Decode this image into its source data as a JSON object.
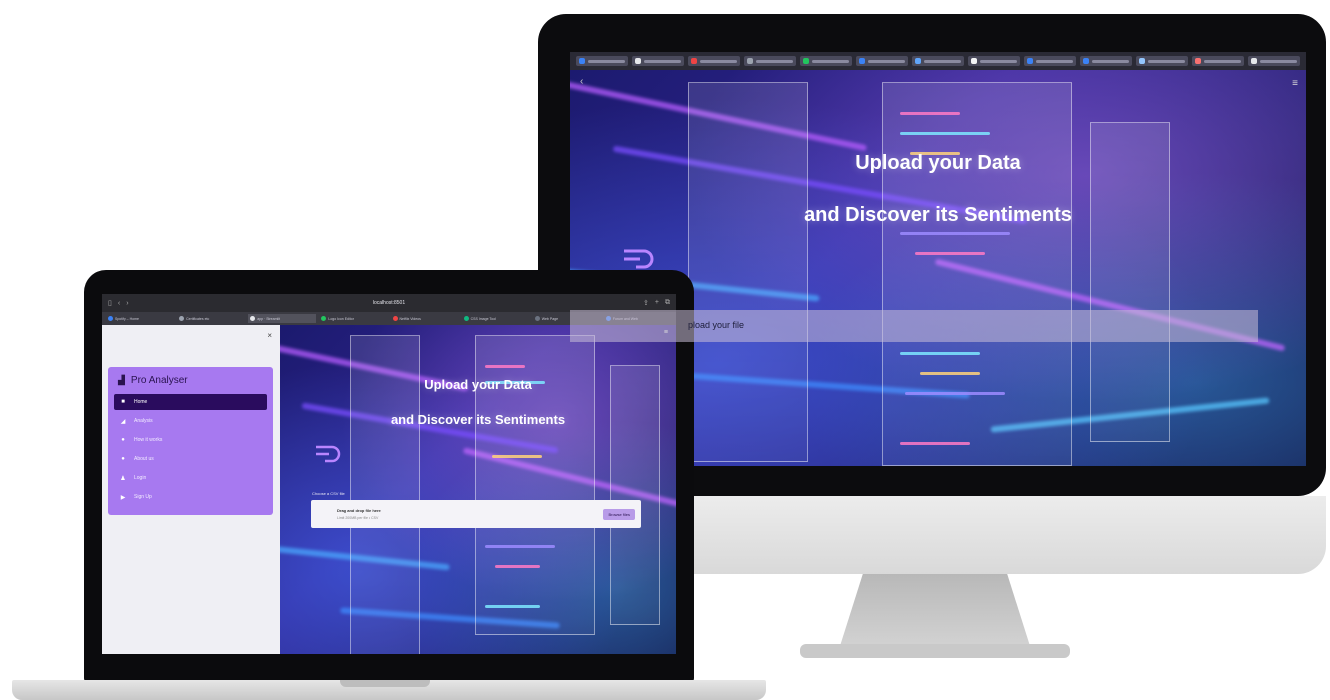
{
  "desktop": {
    "hero_line1": "Upload your Data",
    "hero_line2": "and Discover its Sentiments",
    "upload_label": "pload your file"
  },
  "laptop": {
    "browser": {
      "url": "localhost:8501",
      "tabs": [
        {
          "label": "Spotify – Home",
          "color": "#3b82f6"
        },
        {
          "label": "Certificates etc",
          "color": "#9ca3af"
        },
        {
          "label": "app · Streamlit",
          "color": "#e5e7eb"
        },
        {
          "label": "Logo Icon Editor",
          "color": "#22c55e"
        },
        {
          "label": "Netflix Videos",
          "color": "#ef4444"
        },
        {
          "label": "CSS Image Tool",
          "color": "#10b981"
        },
        {
          "label": "Web Page",
          "color": "#6b7280"
        },
        {
          "label": "Forum and Web",
          "color": "#3b82f6"
        }
      ]
    },
    "sidebar": {
      "close_glyph": "×",
      "brand": "Pro Analyser",
      "items": [
        {
          "label": "Home",
          "icon": "home-icon",
          "glyph": "■",
          "active": true
        },
        {
          "label": "Analysis",
          "icon": "chart-icon",
          "glyph": "◢",
          "active": false
        },
        {
          "label": "How it works",
          "icon": "info-icon",
          "glyph": "●",
          "active": false
        },
        {
          "label": "About us",
          "icon": "about-icon",
          "glyph": "●",
          "active": false
        },
        {
          "label": "Login",
          "icon": "login-icon",
          "glyph": "♟",
          "active": false
        },
        {
          "label": "Sign Up",
          "icon": "signup-icon",
          "glyph": "▶",
          "active": false
        }
      ]
    },
    "main": {
      "hero_line1": "Upload your Data",
      "hero_line2": "and Discover its Sentiments",
      "upload_label": "Choose a CSV file",
      "dropzone_title": "Drag and drop file here",
      "dropzone_sub": "Limit 200MB per file • CSV",
      "browse_button": "Browse files"
    }
  },
  "colors": {
    "accent_purple": "#a779f0",
    "active_nav": "#2a0c5e"
  }
}
